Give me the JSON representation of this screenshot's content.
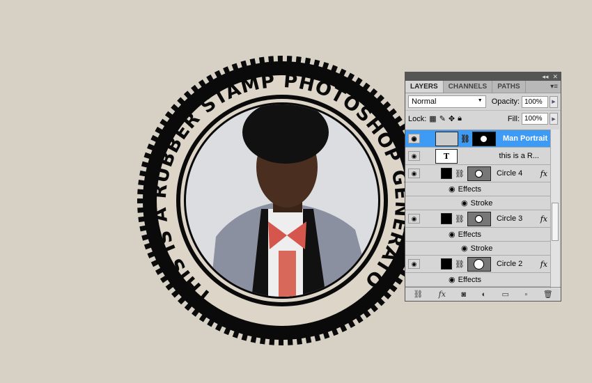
{
  "stamp": {
    "text": "THIS IS A RUBBER STAMP PHOTOSHOP GENERATOR"
  },
  "panel": {
    "tabs": [
      "LAYERS",
      "CHANNELS",
      "PATHS"
    ],
    "blend_mode": "Normal",
    "opacity_label": "Opacity:",
    "opacity": "100%",
    "lock_label": "Lock:",
    "fill_label": "Fill:",
    "fill": "100%",
    "layers": [
      {
        "name": "Man Portrait"
      },
      {
        "name": "this is a R..."
      },
      {
        "name": "Circle 4",
        "effects": "Effects",
        "stroke": "Stroke"
      },
      {
        "name": "Circle 3",
        "effects": "Effects",
        "stroke": "Stroke"
      },
      {
        "name": "Circle 2",
        "effects": "Effects"
      }
    ],
    "fx": "fx",
    "text_thumb": "T"
  },
  "colors": {
    "selection": "#3d9bf5",
    "ink": "#0a0a0a",
    "paper": "#d7d1c5"
  }
}
